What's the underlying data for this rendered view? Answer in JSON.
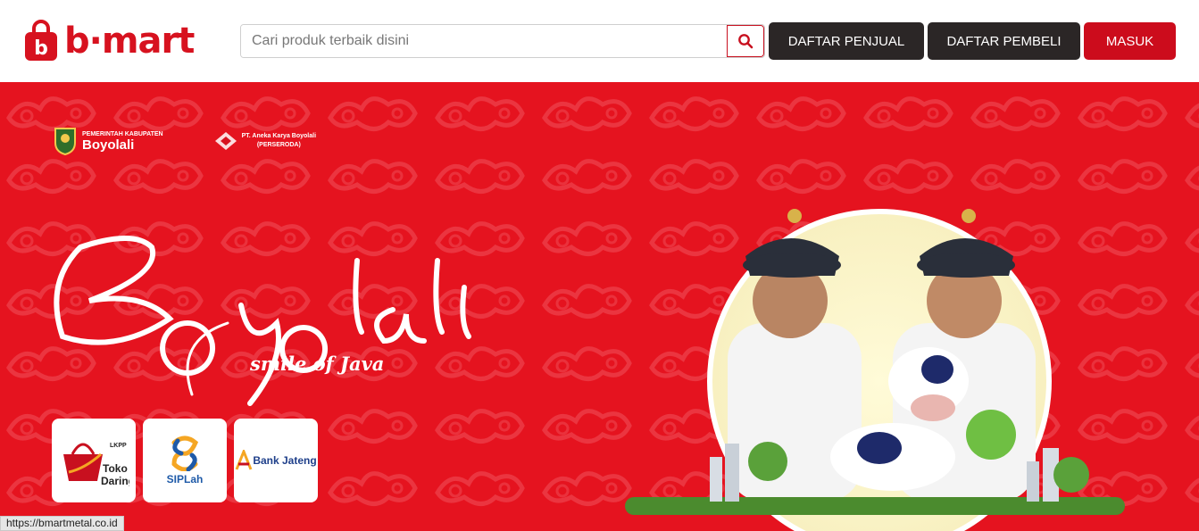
{
  "header": {
    "brand": "b·mart",
    "search": {
      "placeholder": "Cari produk terbaik disini",
      "value": "",
      "icon": "search-icon"
    },
    "buttons": {
      "seller": "DAFTAR PENJUAL",
      "buyer": "DAFTAR PEMBELI",
      "login": "MASUK"
    }
  },
  "banner": {
    "gov_logo": {
      "line1": "PEMERINTAH KABUPATEN",
      "line2": "Boyolali"
    },
    "company_logo": {
      "line1": "PT. Aneka Karya Boyolali",
      "line2": "(PERSERODA)"
    },
    "headline": "Boyolali",
    "tagline": "smile of Java",
    "partners": [
      {
        "name": "Toko Daring",
        "line1": "Toko",
        "line2": "Daring",
        "badge": "LKPP"
      },
      {
        "name": "SIPLah",
        "label": "SIPLah"
      },
      {
        "name": "Bank Jateng",
        "label": "Bank Jateng"
      }
    ]
  },
  "status_bar": {
    "url": "https://bmartmetal.co.id"
  },
  "colors": {
    "brand_red": "#d7121f",
    "dark_button": "#2b2626",
    "login_button": "#cc0c1c",
    "banner_red": "#e5131f"
  }
}
